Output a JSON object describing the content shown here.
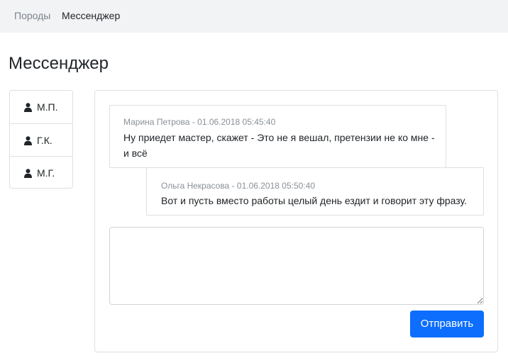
{
  "breadcrumb": {
    "items": [
      {
        "label": "Породы"
      },
      {
        "label": "Мессенджер"
      }
    ]
  },
  "page": {
    "title": "Мессенджер"
  },
  "users": {
    "icon": "user-icon",
    "items": [
      {
        "label": "М.П."
      },
      {
        "label": "Г.К."
      },
      {
        "label": "М.Г."
      }
    ]
  },
  "messages": [
    {
      "header": "Марина Петрова - 01.06.2018 05:45:40",
      "text": "Ну приедет мастер, скажет - Это не я вешал, претензии не ко мне - и всё"
    },
    {
      "header": "Ольга Некрасова - 01.06.2018 05:50:40",
      "text": "Вот и пусть вместо работы целый день ездит и говорит эту фразу."
    }
  ],
  "compose": {
    "value": "",
    "send_label": "Отправить"
  },
  "colors": {
    "accent": "#0d6efd",
    "breadcrumb_bg": "#f2f3f5",
    "border": "#dcdfe3",
    "muted_text": "#8a9096"
  }
}
